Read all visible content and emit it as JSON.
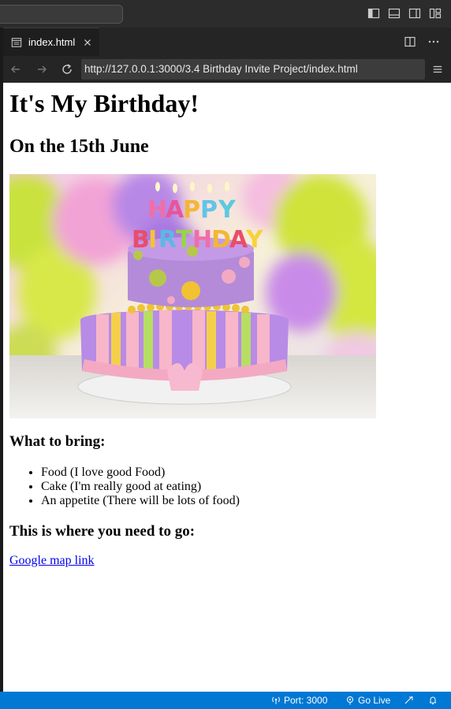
{
  "editor": {
    "tab": {
      "label": "index.html",
      "icon": "preview-file-icon"
    },
    "layout_icons": [
      "toggle-primary-sidebar-icon",
      "toggle-panel-icon",
      "toggle-secondary-sidebar-icon",
      "customize-layout-icon"
    ],
    "tab_actions": [
      "split-editor-icon",
      "more-actions-icon"
    ]
  },
  "browser": {
    "url": "http://127.0.0.1:3000/3.4 Birthday Invite Project/index.html",
    "nav": [
      "back-icon",
      "forward-icon",
      "reload-icon"
    ],
    "menu_icon": "hamburger-menu-icon"
  },
  "page": {
    "heading": "It's My Birthday!",
    "subheading": "On the 15th June",
    "image": {
      "description": "birthday-cake-image",
      "cake_text_line1": "HAPPY",
      "cake_text_line2": "BIRTHDAY"
    },
    "bring_heading": "What to bring:",
    "bring_items": [
      "Food (I love good Food)",
      "Cake (I'm really good at eating)",
      "An appetite (There will be lots of food)"
    ],
    "where_heading": "This is where you need to go:",
    "map_link": "Google map link"
  },
  "statusbar": {
    "port": "Port: 3000",
    "go_live": "Go Live",
    "color": "#0078d4"
  }
}
